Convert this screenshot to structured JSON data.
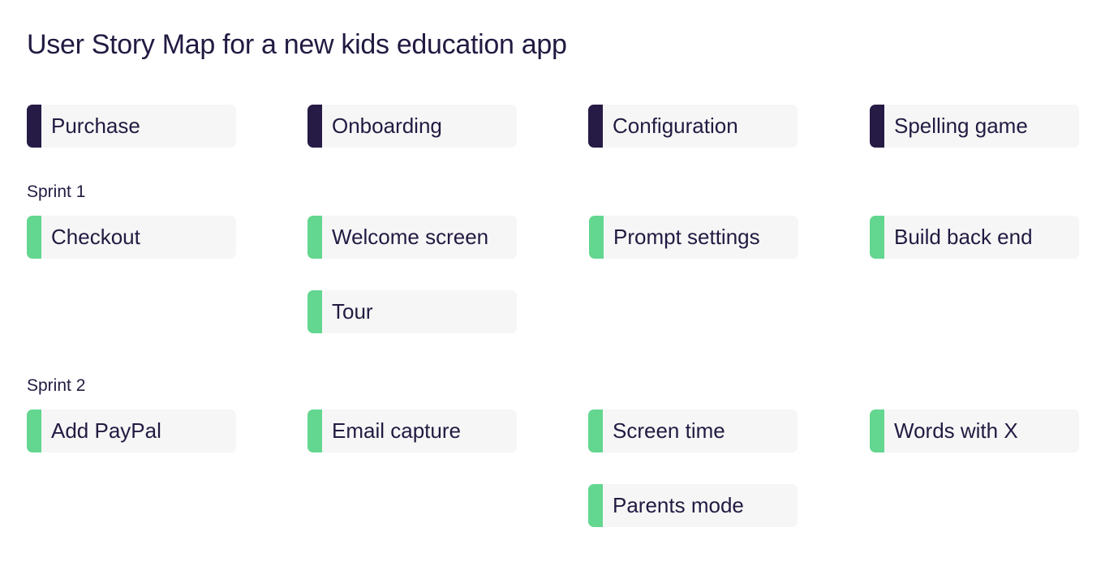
{
  "title": "User Story Map for a new kids education app",
  "colors": {
    "epic_accent": "#251b45",
    "story_accent": "#63d690",
    "card_bg": "#f6f6f6",
    "text": "#231a42"
  },
  "epics": [
    "Purchase",
    "Onboarding",
    "Configuration",
    "Spelling game"
  ],
  "sprints": [
    {
      "label": "Sprint 1",
      "columns": [
        [
          "Checkout"
        ],
        [
          "Welcome screen",
          "Tour"
        ],
        [
          "Prompt settings"
        ],
        [
          "Build back end"
        ]
      ]
    },
    {
      "label": "Sprint 2",
      "columns": [
        [
          "Add PayPal"
        ],
        [
          "Email capture"
        ],
        [
          "Screen time",
          "Parents mode"
        ],
        [
          "Words with X"
        ]
      ]
    }
  ]
}
